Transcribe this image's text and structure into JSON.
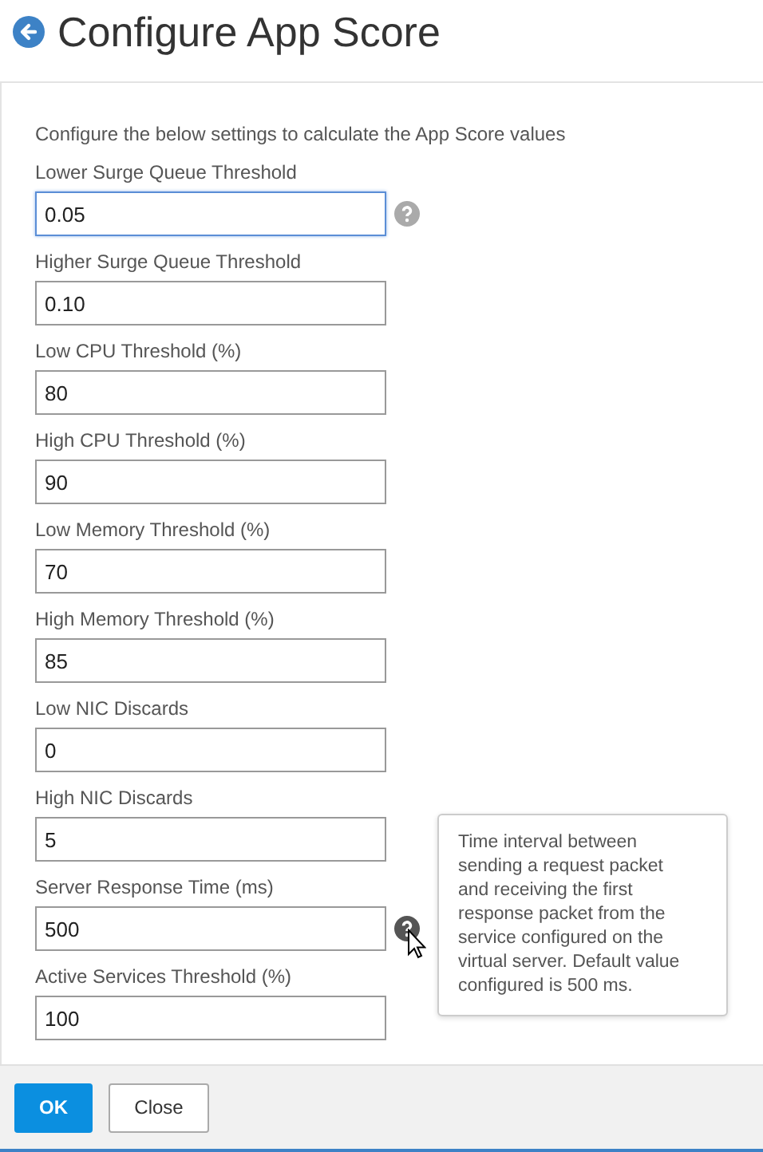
{
  "title": "Configure App Score",
  "intro": "Configure the below settings to calculate the App Score values",
  "fields": [
    {
      "label": "Lower Surge Queue Threshold",
      "value": "0.05",
      "focused": true,
      "help": {
        "active": false
      }
    },
    {
      "label": "Higher Surge Queue Threshold",
      "value": "0.10",
      "focused": false
    },
    {
      "label": "Low CPU Threshold (%)",
      "value": "80",
      "focused": false
    },
    {
      "label": "High CPU Threshold (%)",
      "value": "90",
      "focused": false
    },
    {
      "label": "Low Memory Threshold (%)",
      "value": "70",
      "focused": false
    },
    {
      "label": "High Memory Threshold (%)",
      "value": "85",
      "focused": false
    },
    {
      "label": "Low NIC Discards",
      "value": "0",
      "focused": false
    },
    {
      "label": "High NIC Discards",
      "value": "5",
      "focused": false
    },
    {
      "label": "Server Response Time (ms)",
      "value": "500",
      "focused": false,
      "help": {
        "active": true,
        "tooltip": "Time interval between sending a request packet and receiving the first response packet from the service configured on the virtual server. Default value configured is 500 ms."
      }
    },
    {
      "label": "Active Services Threshold (%)",
      "value": "100",
      "focused": false
    }
  ],
  "buttons": [
    {
      "label": "OK",
      "kind": "primary"
    },
    {
      "label": "Close",
      "kind": "secondary"
    }
  ]
}
